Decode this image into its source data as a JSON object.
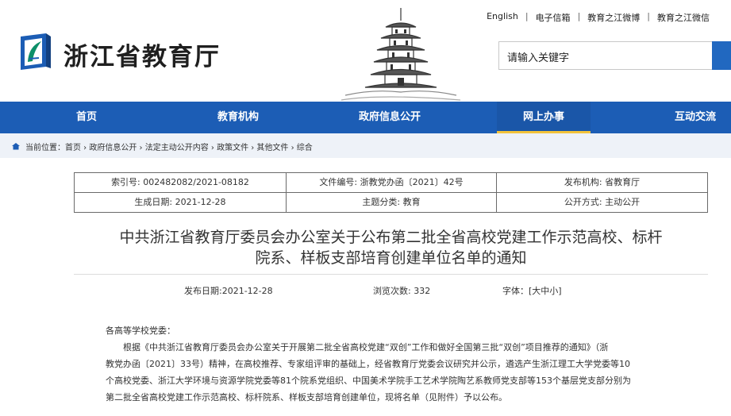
{
  "header": {
    "site_title": "浙江省教育厅",
    "top_links": [
      "English",
      "电子信箱",
      "教育之江微博",
      "教育之江微信"
    ],
    "search_placeholder": "请输入关键字"
  },
  "nav": {
    "items": [
      {
        "label": "首页",
        "active": false
      },
      {
        "label": "教育机构",
        "active": false
      },
      {
        "label": "政府信息公开",
        "active": false
      },
      {
        "label": "网上办事",
        "active": true
      },
      {
        "label": "互动交流",
        "active": false
      }
    ]
  },
  "breadcrumb": {
    "prefix": "当前位置：",
    "path": [
      "首页",
      "政府信息公开",
      "法定主动公开内容",
      "政策文件",
      "其他文件",
      "综合"
    ],
    "separator": "›",
    "text": "首页 › 政府信息公开 › 法定主动公开内容 › 政策文件 › 其他文件 › 综合"
  },
  "meta": {
    "index_no": "索引号: 002482082/2021-08182",
    "doc_no": "文件编号: 浙教党办函〔2021〕42号",
    "publisher": "发布机构: 省教育厅",
    "created": "生成日期: 2021-12-28",
    "topic": "主题分类: 教育",
    "open_mode": "公开方式: 主动公开"
  },
  "article": {
    "title_line1": "中共浙江省教育厅委员会办公室关于公布第二批全省高校党建工作示范高校、标杆",
    "title_line2": "院系、样板支部培育创建单位名单的通知",
    "publish_date": "发布日期:2021-12-28",
    "views": "浏览次数: 332",
    "font_size_label": "字体：[",
    "font_sizes": [
      "大",
      "中",
      "小"
    ],
    "font_size_close": "]",
    "salutation": "各高等学校党委：",
    "para1_line1": "根据《中共浙江省教育厅委员会办公室关于开展第二批全省高校党建“双创”工作和做好全国第三批“双创”项目推荐的通知》（浙",
    "para1_line2": "教党办函〔2021〕33号）精神，在高校推荐、专家组评审的基础上，经省教育厅党委会议研究并公示，遴选产生浙江理工大学党委等10",
    "para1_line3": "个高校党委、浙江大学环境与资源学院党委等81个院系党组织、中国美术学院手工艺术学院陶艺系教师党支部等153个基层党支部分别为",
    "para1_line4": "第二批全省高校党建工作示范高校、标杆院系、样板支部培育创建单位，现将名单（见附件）予以公布。"
  }
}
